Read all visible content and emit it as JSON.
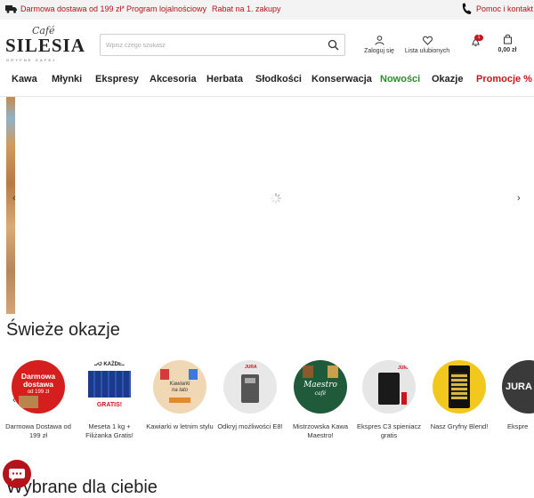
{
  "topbar": {
    "free_shipping": "Darmowa dostawa od 199 zł*",
    "loyalty": "Program lojalnościowy",
    "discount": "Rabat na 1. zakupy",
    "contact": "Pomoc i kontakt"
  },
  "logo": {
    "cafe": "Café",
    "name": "SILESIA",
    "tagline": "GRYFNE KAFEJ"
  },
  "search": {
    "placeholder": "Wpisz czego szukasz"
  },
  "header": {
    "login": "Zaloguj się",
    "wishlist": "Lista ulubionych",
    "notifications_badge": "1",
    "cart_total": "0,00 zł"
  },
  "nav": {
    "items": [
      "Kawa",
      "Młynki",
      "Ekspresy",
      "Akcesoria",
      "Herbata",
      "Słodkości",
      "Konserwacja",
      "Nowości",
      "Okazje",
      "Promocje %"
    ]
  },
  "hero": {
    "prev": "‹",
    "next": "›"
  },
  "sections": {
    "fresh_deals": "Świeże okazje",
    "picked_for_you": "Wybrane dla ciebie"
  },
  "deals": [
    {
      "caption": "Darmowa Dostawa od 199 zł",
      "art_line1": "Darmowa",
      "art_line2": "dostawa",
      "art_line3": "od 199 zł"
    },
    {
      "caption": "Meseta 1 kg + Filiżanka Gratis!",
      "art_line1": "DO KAŻDEJ",
      "art_line2": "GRATIS!"
    },
    {
      "caption": "Kawiarki w letnim stylu",
      "art_line1": "Kawiarki",
      "art_line2": "na lato"
    },
    {
      "caption": "Odkryj możliwości E8!",
      "art_line1": "JURA"
    },
    {
      "caption": "Mistrzowska Kawa Maestro!",
      "art_line1": "Maestro",
      "art_line2": "café"
    },
    {
      "caption": "Ekspres C3 spieniacz gratis",
      "art_line1": "JURA"
    },
    {
      "caption": "Nasz Gryfny Blend!"
    },
    {
      "caption": "Ekspre",
      "art_line1": "JURA"
    }
  ],
  "colors": {
    "brand_red": "#b5121b",
    "new_green": "#2e8b2e",
    "promo_red": "#c8161d"
  }
}
